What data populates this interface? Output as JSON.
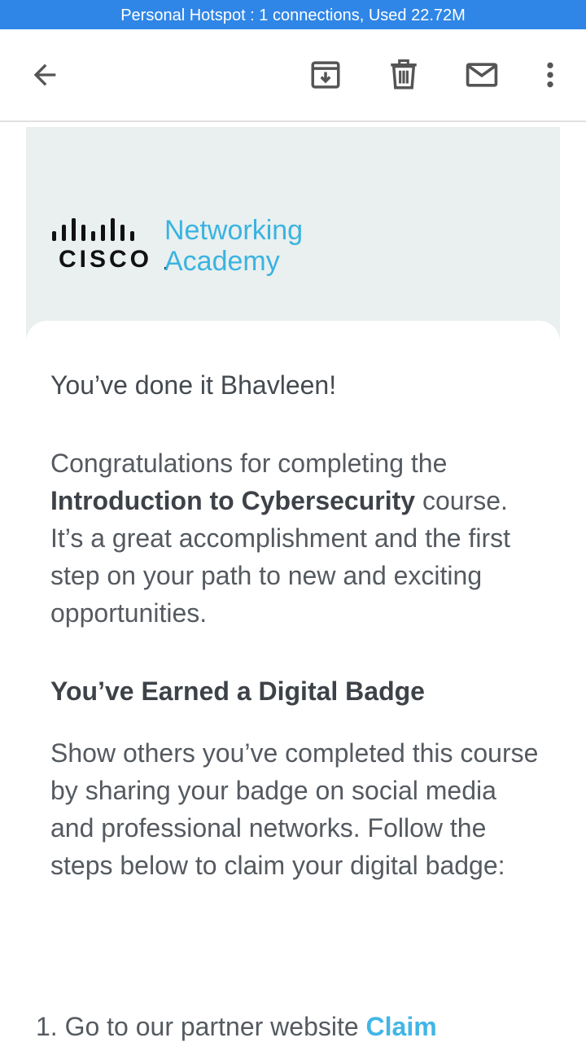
{
  "status_bar": {
    "text": "Personal Hotspot : 1 connections, Used 22.72M"
  },
  "toolbar": {
    "back_icon": "arrow-left-icon",
    "archive_icon": "archive-icon",
    "delete_icon": "trash-icon",
    "mark_unread_icon": "mail-icon",
    "more_icon": "more-vertical-icon"
  },
  "email": {
    "logo": {
      "brand": "CISCO",
      "line1": "Networking",
      "line2": "Academy"
    },
    "greeting": "You’ve done it Bhavleen!",
    "congrats_prefix": "Congratulations for completing the",
    "course_name": "Introduction to Cybersecurity",
    "congrats_suffix": "course. It’s a great accomplishment and the first step on your path to new and exciting opportunities.",
    "badge_heading": "You’ve Earned a Digital Badge",
    "badge_text": "Show others you’ve completed this course by sharing your badge on social media and professional networks. Follow the steps below to claim your digital badge:",
    "steps": [
      {
        "number": "1.",
        "text": "Go to our partner website",
        "link_text": "Claim"
      }
    ]
  },
  "colors": {
    "status_bar": "#2f86e6",
    "header_band": "#e9f0ef",
    "accent_link": "#41b6e6",
    "logo_text": "#3ab3e0"
  }
}
